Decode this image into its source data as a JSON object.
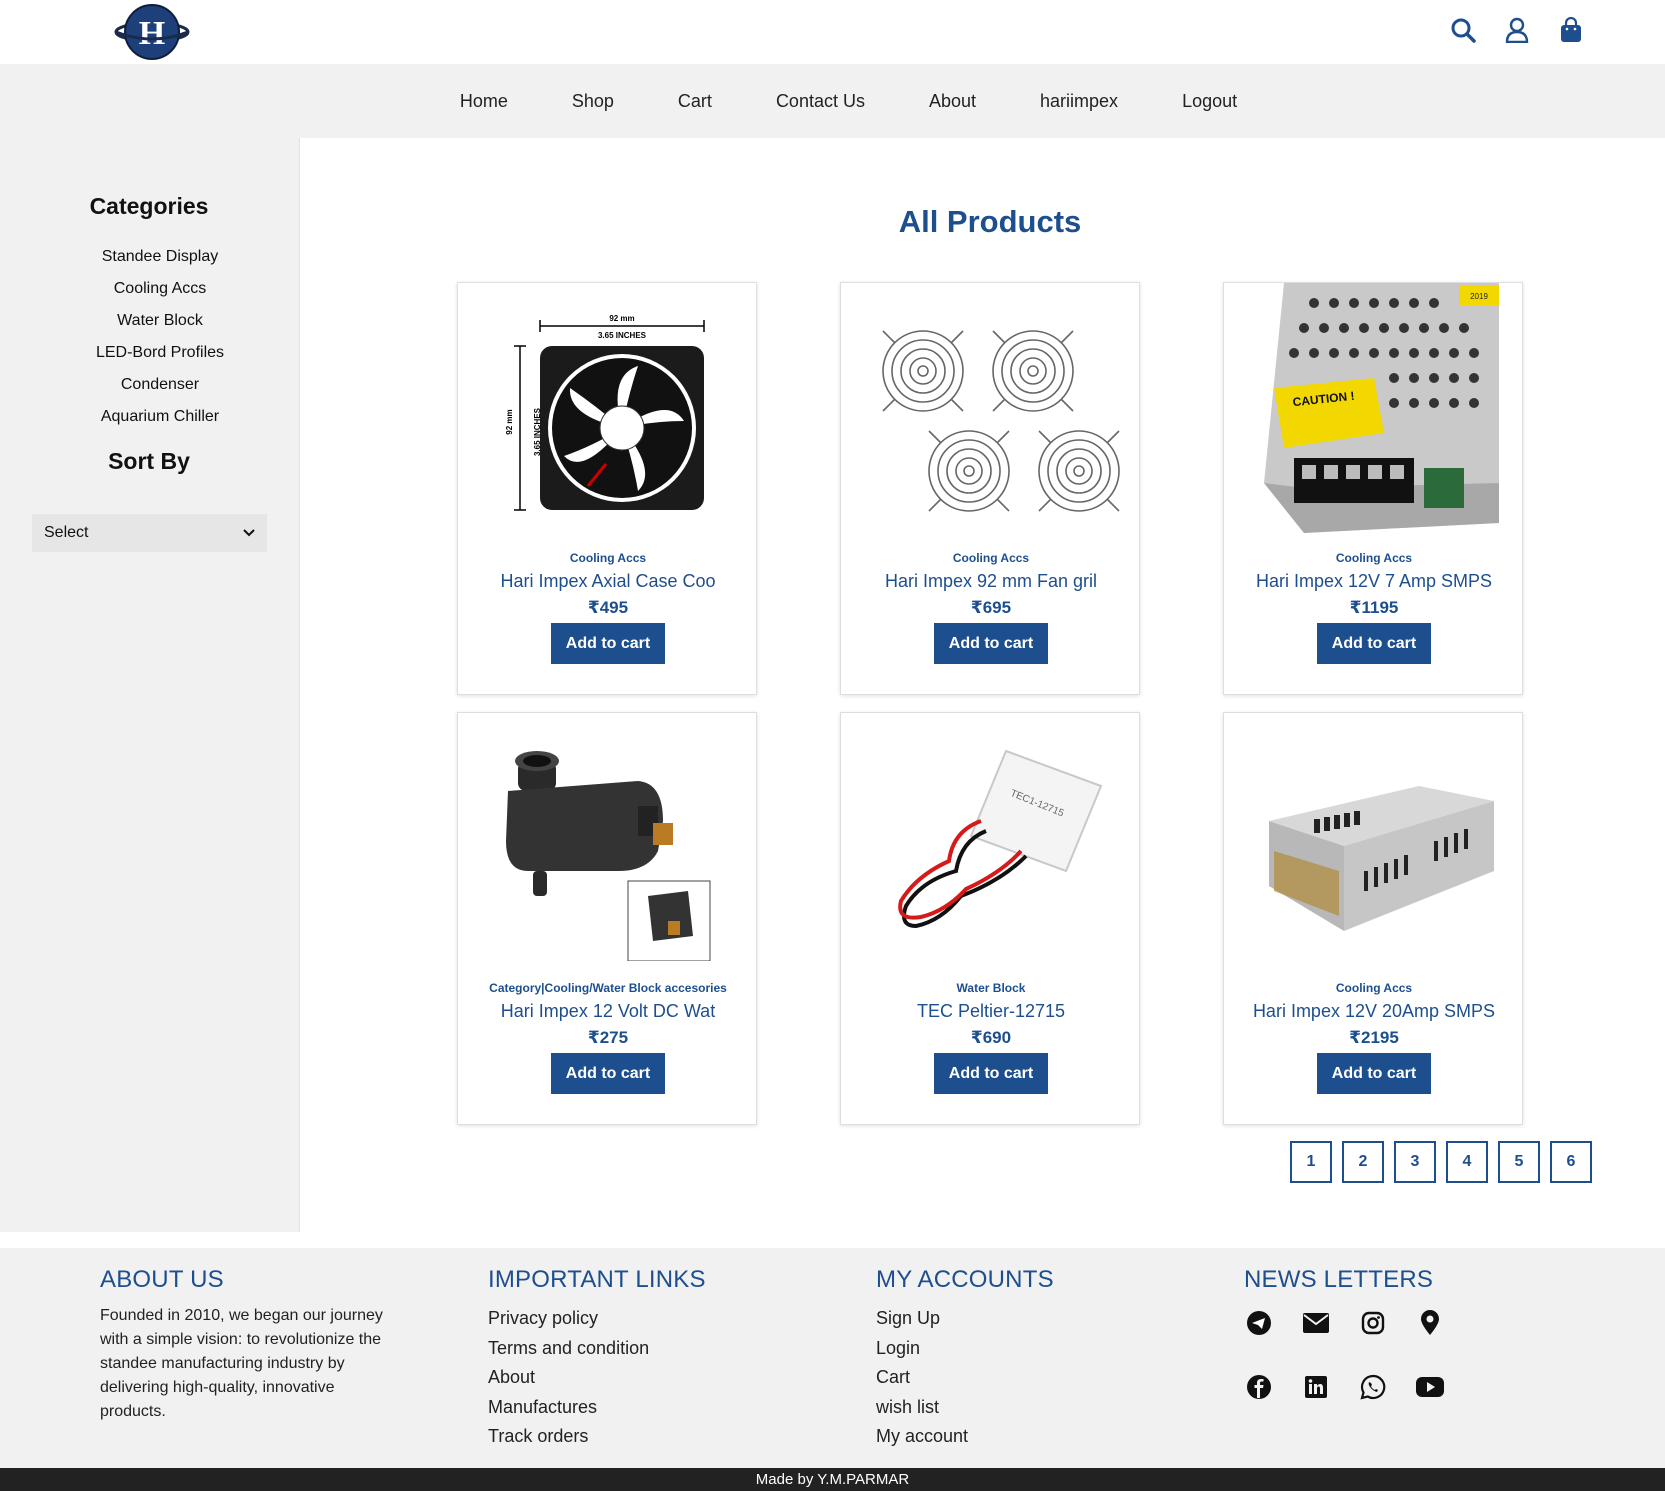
{
  "header": {
    "logo_letter": "H",
    "icons": [
      "search-icon",
      "user-icon",
      "bag-icon"
    ],
    "accent_color": "#1d4f8e"
  },
  "nav": {
    "items": [
      "Home",
      "Shop",
      "Cart",
      "Contact Us",
      "About",
      "hariimpex",
      "Logout"
    ]
  },
  "sidebar": {
    "categories_title": "Categories",
    "categories": [
      "Standee Display",
      "Cooling Accs",
      "Water Block",
      "LED-Bord Profiles",
      "Condenser",
      "Aquarium Chiller"
    ],
    "sort_title": "Sort By",
    "sort_value": "Select"
  },
  "main": {
    "title": "All Products",
    "products": [
      {
        "category": "Cooling Accs",
        "name": "Hari Impex Axial Case Coo",
        "price": "₹495",
        "button": "Add to cart",
        "image": "fan-image"
      },
      {
        "category": "Cooling Accs",
        "name": "Hari Impex 92 mm Fan gril",
        "price": "₹695",
        "button": "Add to cart",
        "image": "fan-grill-image"
      },
      {
        "category": "Cooling Accs",
        "name": "Hari Impex 12V 7 Amp SMPS",
        "price": "₹1195",
        "button": "Add to cart",
        "image": "smps-image"
      },
      {
        "category": "Category|Cooling/Water Block accesories",
        "name": "Hari Impex 12 Volt DC Wat",
        "price": "₹275",
        "button": "Add to cart",
        "image": "pump-image"
      },
      {
        "category": "Water Block",
        "name": "TEC Peltier-12715",
        "price": "₹690",
        "button": "Add to cart",
        "image": "peltier-image"
      },
      {
        "category": "Cooling Accs",
        "name": "Hari Impex 12V 20Amp SMPS",
        "price": "₹2195",
        "button": "Add to cart",
        "image": "smps-large-image"
      }
    ],
    "fan_image_labels": {
      "top_mm": "92 mm",
      "top_in": "3.65 INCHES",
      "side_mm": "92 mm",
      "side_in": "3.65 INCHES"
    },
    "smps_labels": {
      "caution": "CAUTION !",
      "year": "2019"
    },
    "peltier_label": "TEC1-12715",
    "pages": [
      "1",
      "2",
      "3",
      "4",
      "5",
      "6"
    ]
  },
  "footer": {
    "about_title": "ABOUT US",
    "about_text": "Founded in 2010, we began our journey with a simple vision: to revolutionize the standee manufacturing industry by delivering high-quality, innovative products.",
    "links_title": "IMPORTANT LINKS",
    "links": [
      "Privacy policy",
      "Terms and condition",
      "About",
      "Manufactures",
      "Track orders"
    ],
    "accounts_title": "MY ACCOUNTS",
    "accounts": [
      "Sign Up",
      "Login",
      "Cart",
      "wish list",
      "My account"
    ],
    "news_title": "NEWS LETTERS",
    "social_icons": [
      "telegram-icon",
      "email-icon",
      "instagram-icon",
      "location-icon",
      "facebook-icon",
      "linkedin-icon",
      "whatsapp-icon",
      "youtube-icon"
    ]
  },
  "credits": "Made by Y.M.PARMAR"
}
